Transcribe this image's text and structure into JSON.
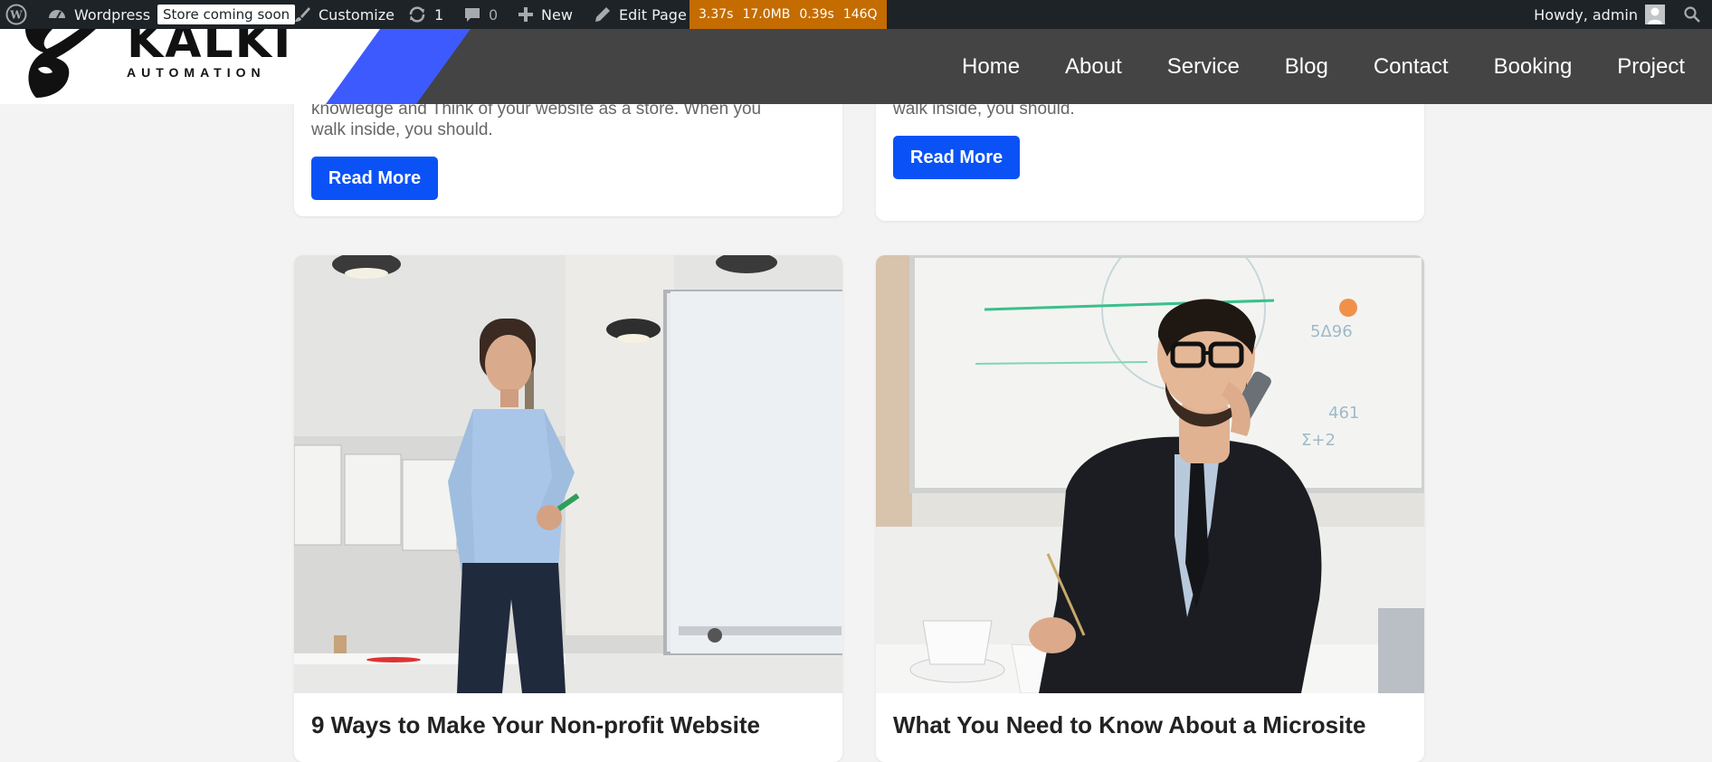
{
  "admin_bar": {
    "site_name": "Wordpress",
    "store_badge": "Store coming soon",
    "customize": "Customize",
    "updates_count": "1",
    "comments_count": "0",
    "new_label": "New",
    "edit_page": "Edit Page",
    "qm": {
      "time": "3.37s",
      "memory": "17.0MB",
      "db_time": "0.39s",
      "queries": "146Q"
    },
    "howdy": "Howdy, admin"
  },
  "header": {
    "logo_title": "KALKI",
    "logo_subtitle": "AUTOMATION",
    "nav": [
      "Home",
      "About",
      "Service",
      "Blog",
      "Contact",
      "Booking",
      "Project"
    ]
  },
  "cards_top": [
    {
      "excerpt_lines": [
        "knowledge and Think of your website as a store. When you",
        "walk inside, you should."
      ],
      "button": "Read More"
    },
    {
      "excerpt_lines": [
        "walk inside, you should."
      ],
      "button": "Read More"
    }
  ],
  "cards_bottom": [
    {
      "title": "9 Ways to Make Your Non-profit Website"
    },
    {
      "title": "What You Need to Know About a Microsite"
    }
  ],
  "colors": {
    "accent": "#0a52f5",
    "admin_bar": "#1d2327",
    "qm_bar": "#c46c00",
    "header": "#444444",
    "slash": "#3d5afe"
  }
}
